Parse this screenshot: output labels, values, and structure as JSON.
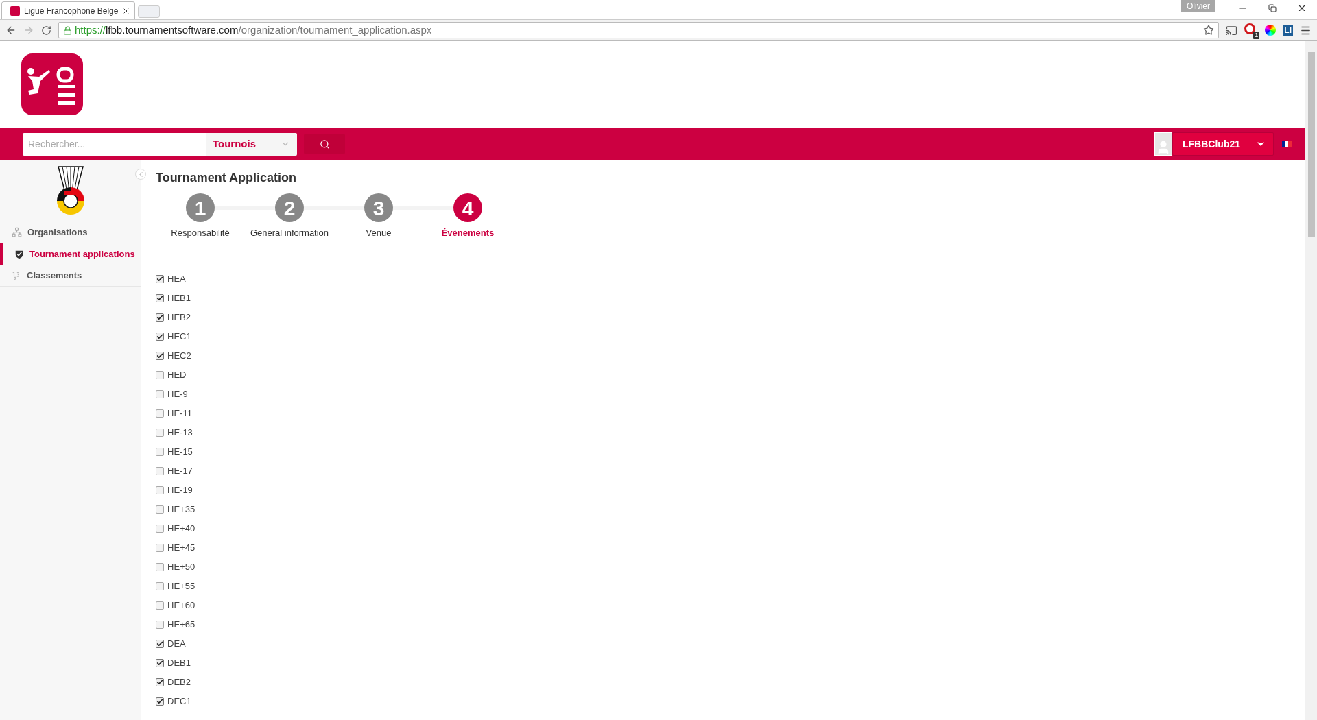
{
  "browser": {
    "tab_title": "Ligue Francophone Belge",
    "profile": "Olivier",
    "url": {
      "scheme": "https://",
      "domain": "lfbb.tournamentsoftware.com",
      "path": "/organization/tournament_application.aspx"
    },
    "extension_badge": "1",
    "extension_label": "LI"
  },
  "navbar": {
    "search": {
      "placeholder": "Rechercher..."
    },
    "category": "Tournois",
    "user": "LFBBClub21"
  },
  "sidebar": {
    "items": [
      {
        "label": "Organisations",
        "kind": "org",
        "selected": false
      },
      {
        "label": "Tournament applications",
        "kind": "shield",
        "selected": true
      },
      {
        "label": "Classements",
        "kind": "ranking",
        "selected": false
      }
    ]
  },
  "page": {
    "title": "Tournament Application",
    "steps": [
      {
        "number": "1",
        "label": "Responsabilité",
        "selected": false
      },
      {
        "number": "2",
        "label": "General information",
        "selected": false
      },
      {
        "number": "3",
        "label": "Venue",
        "selected": false
      },
      {
        "number": "4",
        "label": "Évènements",
        "selected": true
      }
    ],
    "events": [
      {
        "label": "HEA",
        "checked": true
      },
      {
        "label": "HEB1",
        "checked": true
      },
      {
        "label": "HEB2",
        "checked": true
      },
      {
        "label": "HEC1",
        "checked": true
      },
      {
        "label": "HEC2",
        "checked": true
      },
      {
        "label": "HED",
        "checked": false
      },
      {
        "label": "HE-9",
        "checked": false
      },
      {
        "label": "HE-11",
        "checked": false
      },
      {
        "label": "HE-13",
        "checked": false
      },
      {
        "label": "HE-15",
        "checked": false
      },
      {
        "label": "HE-17",
        "checked": false
      },
      {
        "label": "HE-19",
        "checked": false
      },
      {
        "label": "HE+35",
        "checked": false
      },
      {
        "label": "HE+40",
        "checked": false
      },
      {
        "label": "HE+45",
        "checked": false
      },
      {
        "label": "HE+50",
        "checked": false
      },
      {
        "label": "HE+55",
        "checked": false
      },
      {
        "label": "HE+60",
        "checked": false
      },
      {
        "label": "HE+65",
        "checked": false
      },
      {
        "label": "DEA",
        "checked": true
      },
      {
        "label": "DEB1",
        "checked": true
      },
      {
        "label": "DEB2",
        "checked": true
      },
      {
        "label": "DEC1",
        "checked": true
      }
    ]
  }
}
